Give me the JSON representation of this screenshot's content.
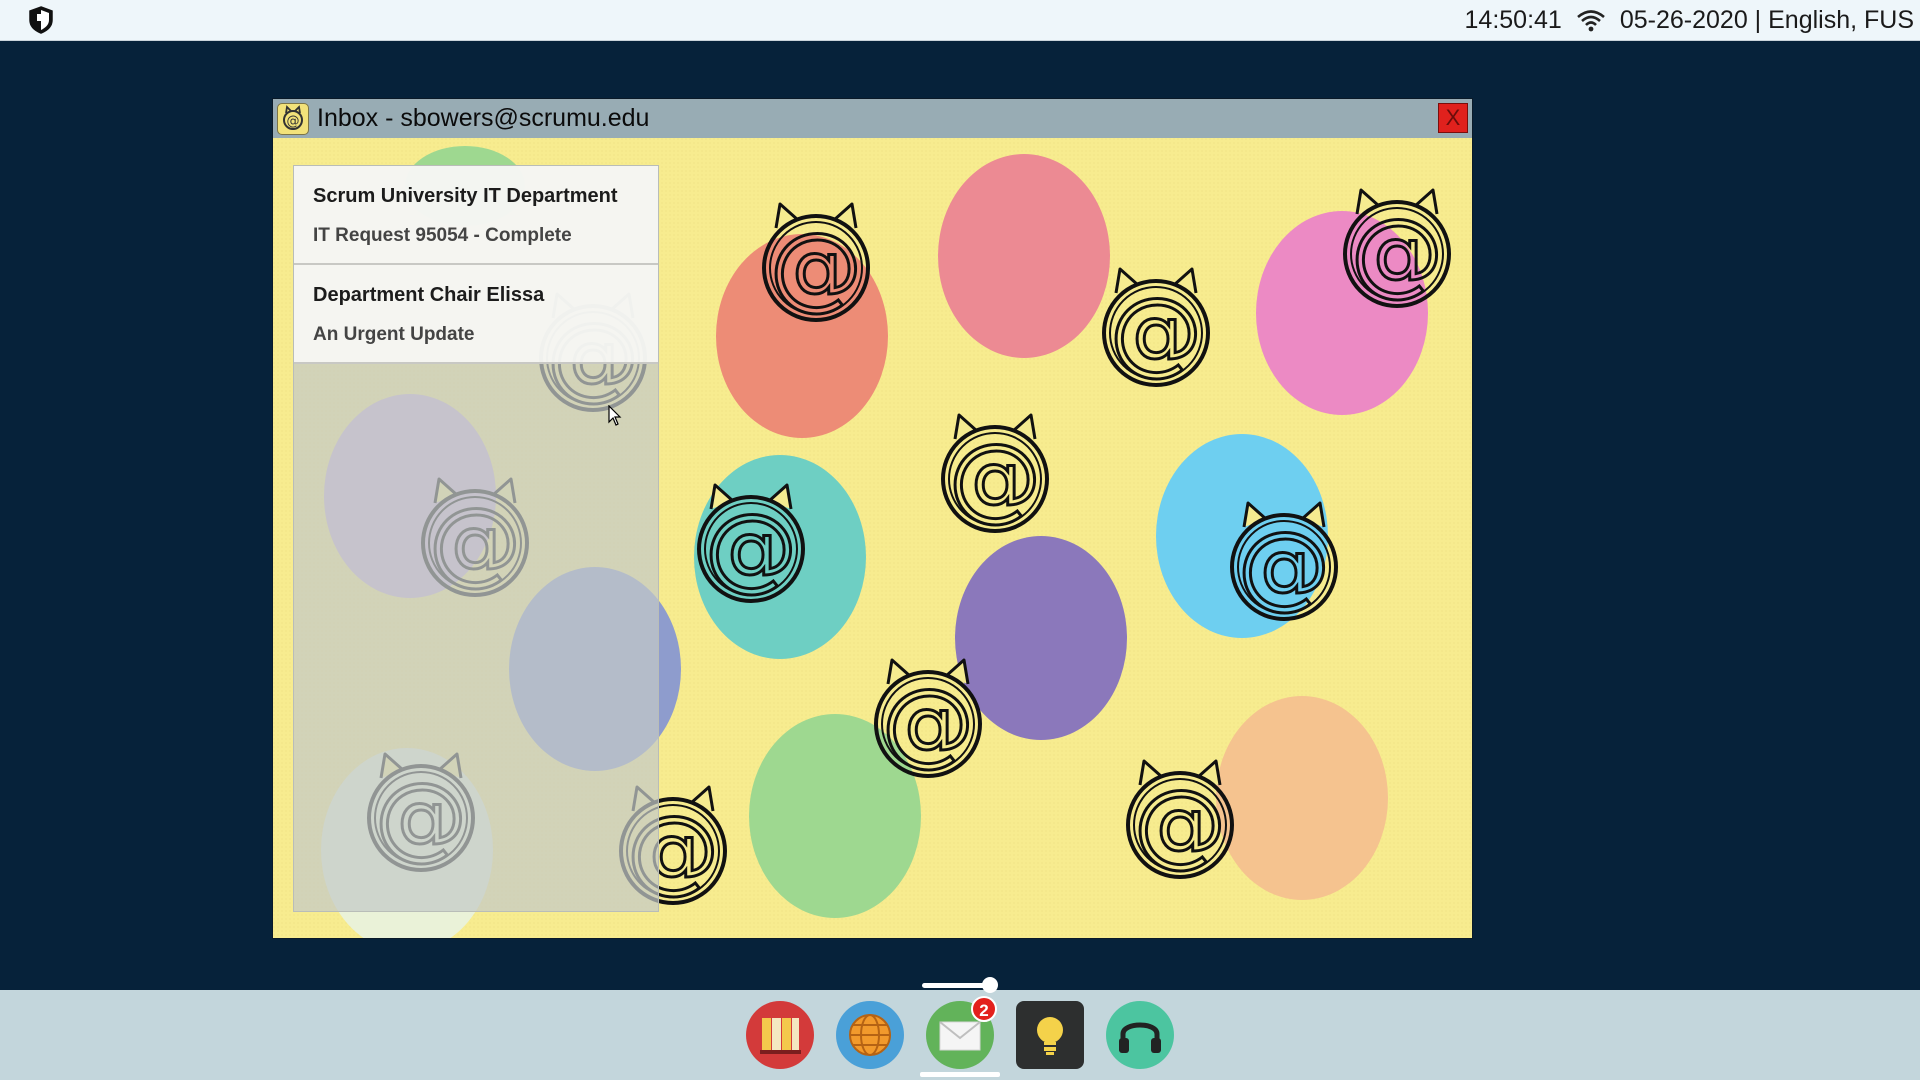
{
  "topbar": {
    "time": "14:50:41",
    "date_locale": "05-26-2020 | English, FUS",
    "icons": {
      "logo": "shield-logo-icon",
      "wifi": "wifi-icon"
    }
  },
  "window": {
    "title": "Inbox - sbowers@scrumu.edu",
    "close_label": "X",
    "icon": "mail-cat-icon"
  },
  "inbox": {
    "messages": [
      {
        "from": "Scrum University IT Department",
        "subject": "IT Request 95054 - Complete"
      },
      {
        "from": "Department Chair Elissa",
        "subject": "An Urgent Update"
      }
    ]
  },
  "dock": {
    "apps": [
      {
        "name": "library",
        "icon": "books-icon"
      },
      {
        "name": "browser",
        "icon": "globe-icon"
      },
      {
        "name": "mail",
        "icon": "envelope-icon",
        "badge": "2"
      },
      {
        "name": "ideas",
        "icon": "lightbulb-icon"
      },
      {
        "name": "audio",
        "icon": "headphones-icon"
      }
    ]
  },
  "colors": {
    "desktop": "#06223a",
    "window_bg": "#f7ec8f",
    "titlebar": "#98acb4",
    "close": "#e0211d"
  }
}
